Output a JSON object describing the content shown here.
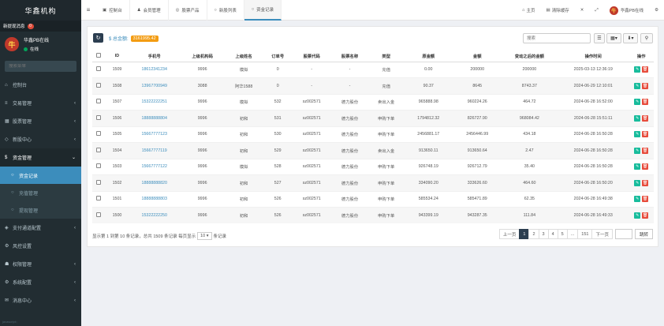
{
  "brand": "华鑫机构",
  "notice": {
    "label": "新提现消息",
    "count": "0"
  },
  "user": {
    "name": "华鑫PB在线",
    "status": "在线",
    "avatar": "牛"
  },
  "sidebar_search_placeholder": "搜索菜单",
  "menu": [
    {
      "label": "控制台",
      "icon": "⌂",
      "chev": ""
    },
    {
      "label": "交易管理",
      "icon": "≡",
      "chev": "‹"
    },
    {
      "label": "股票管理",
      "icon": "▦",
      "chev": "‹"
    },
    {
      "label": "新股中心",
      "icon": "◇",
      "chev": "‹"
    },
    {
      "label": "资金管理",
      "icon": "$",
      "chev": "⌄"
    }
  ],
  "submenu": [
    {
      "label": "资金记录"
    },
    {
      "label": "充值管理"
    },
    {
      "label": "提现管理"
    }
  ],
  "menu_after": [
    {
      "label": "支付通道配置",
      "icon": "◈",
      "chev": "‹"
    },
    {
      "label": "风控设置",
      "icon": "⚙",
      "chev": ""
    },
    {
      "label": "权限管理",
      "icon": "☗",
      "chev": "‹"
    },
    {
      "label": "系统配置",
      "icon": "⚙",
      "chev": "‹"
    },
    {
      "label": "消息中心",
      "icon": "✉",
      "chev": "‹"
    }
  ],
  "footer": "javascript:;",
  "topbar": {
    "tabs": [
      {
        "label": "控制台",
        "icon": "▣"
      },
      {
        "label": "会员管理",
        "icon": "♟"
      },
      {
        "label": "股票产品",
        "icon": "◎"
      },
      {
        "label": "新股列表",
        "icon": "○"
      },
      {
        "label": "资金记录",
        "icon": "○"
      }
    ],
    "home": "主页",
    "clear": "清除缓存",
    "username": "华鑫PB在线"
  },
  "toolbar": {
    "total_label": "$ 总金额:",
    "total_amount": "3161995.42",
    "search_placeholder": "搜索"
  },
  "table": {
    "headers": [
      "",
      "ID",
      "手机号",
      "上级机构码",
      "上级姓名",
      "订单号",
      "股票代码",
      "股票名称",
      "类型",
      "原金额",
      "金额",
      "变动之后的金额",
      "操作时间",
      "操作"
    ],
    "rows": [
      [
        "1509",
        "18612341234",
        "9996",
        "模拟",
        "0",
        "-",
        "-",
        "充值",
        "0.00",
        "200000",
        "200000",
        "2025-03-13 12:36:19"
      ],
      [
        "1508",
        "13967700949",
        "3088",
        "阿华1588",
        "0",
        "-",
        "-",
        "充值",
        "90.37",
        "8645",
        "8743.37",
        "2024-06-29 12:10:01"
      ],
      [
        "1507",
        "15322222251",
        "9996",
        "模拟",
        "532",
        "sz002571",
        "德力股份",
        "卖出入金",
        "965888.98",
        "960224.26",
        "464.72",
        "2024-06-28 16:52:00"
      ],
      [
        "1506",
        "18888888804",
        "9996",
        "初和",
        "531",
        "sz002571",
        "德力股份",
        "申购下单",
        "1794812.32",
        "826727.90",
        "968084.42",
        "2024-06-28 15:51:11"
      ],
      [
        "1505",
        "15667777123",
        "9996",
        "初和",
        "530",
        "sz002571",
        "德力股份",
        "申购下单",
        "2456881.17",
        "2456446.99",
        "434.18",
        "2024-06-28 16:50:28"
      ],
      [
        "1504",
        "15667777119",
        "9996",
        "初和",
        "529",
        "sz002571",
        "德力股份",
        "卖出入金",
        "913650.11",
        "913650.64",
        "2.47",
        "2024-06-28 16:50:28"
      ],
      [
        "1503",
        "15667777122",
        "9996",
        "模拟",
        "528",
        "sz002571",
        "德力股份",
        "申购下单",
        "926748.19",
        "926712.79",
        "35.40",
        "2024-06-28 16:50:28"
      ],
      [
        "1502",
        "18888888820",
        "9996",
        "初和",
        "527",
        "sz002571",
        "德力股份",
        "申购下单",
        "334090.20",
        "333626.60",
        "464.60",
        "2024-06-28 16:50:20"
      ],
      [
        "1501",
        "18888888803",
        "9996",
        "初和",
        "526",
        "sz002571",
        "德力股份",
        "申购下单",
        "585534.24",
        "585471.89",
        "62.35",
        "2024-06-28 16:49:38"
      ],
      [
        "1500",
        "15322222250",
        "9996",
        "初和",
        "526",
        "sz002571",
        "德力股份",
        "申购下单",
        "943399.19",
        "943287.35",
        "111.84",
        "2024-06-28 16:49:33"
      ]
    ]
  },
  "pager": {
    "info_prefix": "显示第 1 到第 10 条记录，总共 1509 条记录 每页显示",
    "page_size": "10",
    "info_suffix": "条记录",
    "prev": "上一页",
    "pages": [
      "1",
      "2",
      "3",
      "4",
      "5",
      "...",
      "151"
    ],
    "next": "下一页",
    "go": "跳转"
  }
}
